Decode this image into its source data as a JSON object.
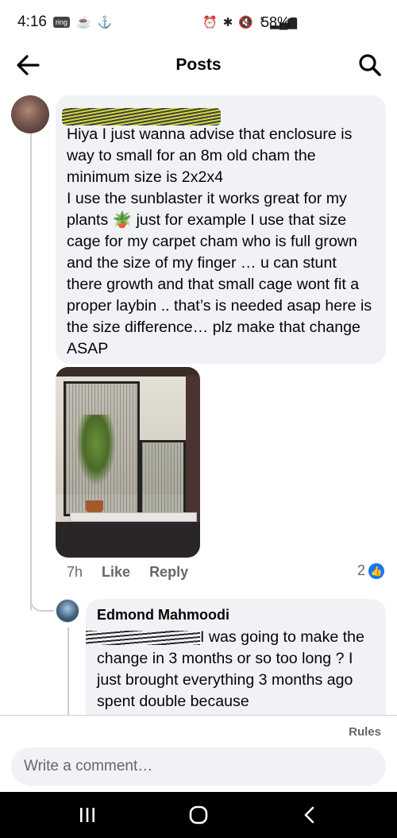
{
  "status_bar": {
    "time": "4:16",
    "ring_badge": "ring",
    "battery": "58%"
  },
  "header": {
    "title": "Posts",
    "back_icon": "arrow-left-icon",
    "search_icon": "search-icon"
  },
  "comment": {
    "text": "Hiya I just wanna advise that enclosure is way to small for an 8m old cham the minimum size is 2x2x4\nI use the sunblaster it works great for my plants 🪴 just for example I use that size cage for my carpet cham who is full grown and the size of my finger … u can stunt there growth and that small cage wont fit a proper laybin .. that’s is needed asap here is the size difference… plz make that change ASAP",
    "time": "7h",
    "like_label": "Like",
    "reply_label": "Reply",
    "reaction_count": "2"
  },
  "reply": {
    "author": "Edmond Mahmoodi",
    "text": "I was going to make the change in 3 months or so too long ? I just brought everything 3 months ago spent double because"
  },
  "footer": {
    "rules_label": "Rules",
    "comment_placeholder": "Write a comment…"
  },
  "colors": {
    "accent": "#1877f2",
    "bubble": "#f0f2f5",
    "muted_text": "#65676b"
  }
}
